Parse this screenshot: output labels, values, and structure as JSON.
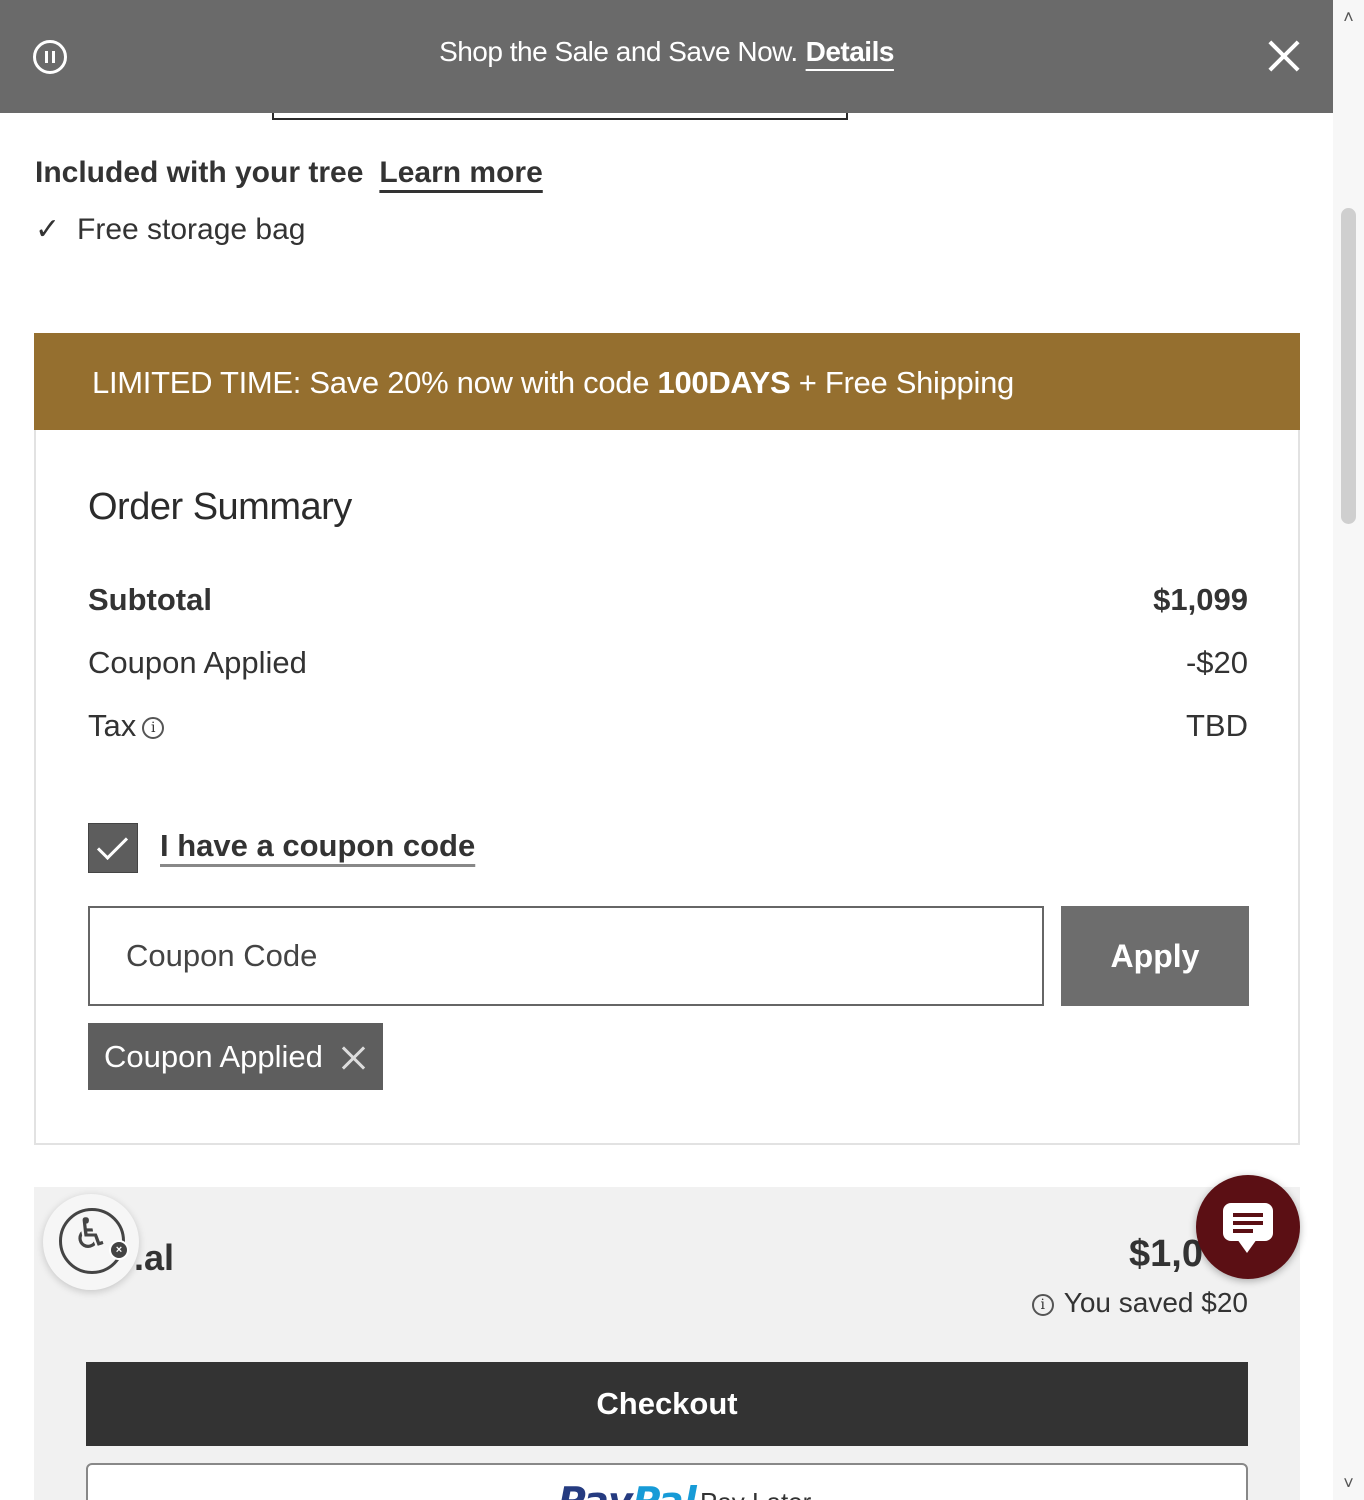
{
  "promo_bar": {
    "text": "Shop the Sale and Save Now.",
    "details_link": "Details"
  },
  "included": {
    "title": "Included with your tree",
    "learn_more": "Learn more",
    "items": [
      "Free storage bag"
    ]
  },
  "limited_banner": {
    "prefix": "LIMITED TIME: Save 20% now with code ",
    "code": "100DAYS",
    "suffix": " + Free Shipping"
  },
  "order_summary": {
    "title": "Order Summary",
    "subtotal_label": "Subtotal",
    "subtotal_value": "$1,099",
    "coupon_label": "Coupon Applied",
    "coupon_value": "-$20",
    "tax_label": "Tax",
    "tax_value": "TBD",
    "coupon_checkbox_label": "I have a coupon code",
    "coupon_checkbox_checked": true,
    "coupon_input_placeholder": "Coupon Code",
    "apply_button": "Apply",
    "coupon_chip": "Coupon Applied"
  },
  "total": {
    "label": ".al",
    "value": "$1,0",
    "saved": "You saved $20",
    "checkout_button": "Checkout",
    "paypal_brand_pay": "Pay",
    "paypal_brand_pal": "Pal",
    "paypal_later": "Pay Later"
  },
  "colors": {
    "promo_bar": "#6a6a6a",
    "limited_banner": "#956f2f",
    "checkout_button": "#333333",
    "chat_widget": "#5b0f14"
  },
  "icons": {
    "pause": "pause-icon",
    "close": "close-icon",
    "check": "checkmark-icon",
    "info": "info-icon",
    "accessibility": "accessibility-icon",
    "chat": "chat-icon"
  }
}
